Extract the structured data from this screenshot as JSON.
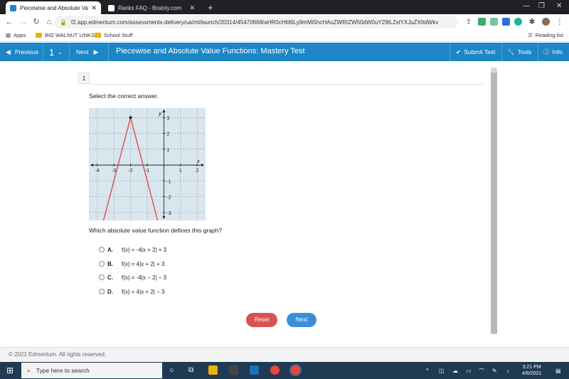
{
  "browser": {
    "tabs": [
      {
        "title": "Piecewise and Absolute Value Fu",
        "active": true
      },
      {
        "title": "Ranks FAQ - Brainly.com",
        "active": false
      }
    ],
    "new_tab": "+",
    "url": "f2.app.edmentum.com/assessments-delivery/ua/mt/launch/20314/45470668/aHR0cHM6Ly9mMi5hcHAuZWRtZW50dW0uY29tL2xlYXJuZXItdWkv",
    "bookmarks": [
      "Apps",
      "BIG WALNUT LINKS",
      "School Stuff"
    ],
    "reading_list": "Reading list"
  },
  "header": {
    "previous": "Previous",
    "question_number": "1",
    "next": "Next",
    "title": "Piecewise and Absolute Value Functions: Mastery Test",
    "submit": "Submit Test",
    "tools": "Tools",
    "info": "Info"
  },
  "question": {
    "number": "1",
    "prompt": "Select the correct answer.",
    "text": "Which absolute value function defines this graph?",
    "choices": [
      {
        "letter": "A.",
        "text": "f(x) = -4|x + 2| + 3"
      },
      {
        "letter": "B.",
        "text": "f(x) = 4|x + 2| + 3"
      },
      {
        "letter": "C.",
        "text": "f(x) = -4|x − 2| − 3"
      },
      {
        "letter": "D.",
        "text": "f(x) = 4|x + 2| − 3"
      }
    ]
  },
  "graph": {
    "x_label": "x",
    "y_label": "y",
    "x_ticks": [
      "-4",
      "-3",
      "-2",
      "-1",
      "1",
      "2"
    ],
    "y_ticks": [
      "3",
      "2",
      "1",
      "-1",
      "-2",
      "-3"
    ],
    "x_range": [
      -4.5,
      2.5
    ],
    "y_range": [
      -3.5,
      3.6
    ],
    "vertex": [
      -2,
      3
    ],
    "function": "y = -4|x + 2| + 3",
    "line_color": "#e8484a",
    "background": "#d9e6ee"
  },
  "buttons": {
    "reset": "Reset",
    "next": "Next"
  },
  "footer": {
    "copyright": "© 2021 Edmentum. All rights reserved."
  },
  "taskbar": {
    "search_placeholder": "Type here to search",
    "time": "3:21 PM",
    "date": "4/6/2021"
  },
  "colors": {
    "header": "#1c86c6",
    "reset": "#d9534f",
    "next": "#3a8fd9",
    "taskbar": "#1f3a52"
  }
}
